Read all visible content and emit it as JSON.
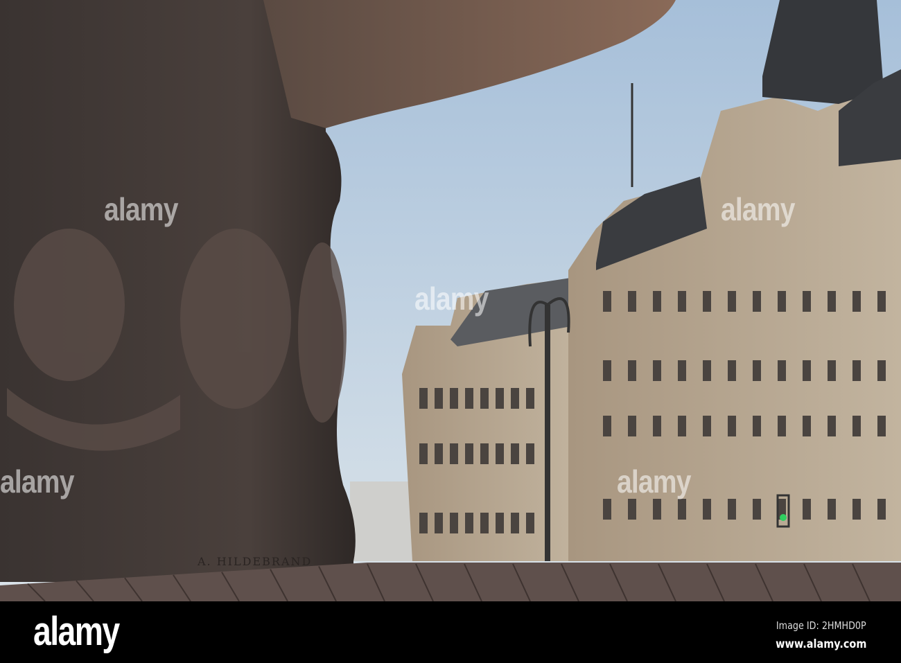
{
  "photo": {
    "subject": "Fountain base with carved faces in front of historic buildings",
    "inscription": "A. HILDEBRAND",
    "colors": {
      "sky_top": "#a9c2dc",
      "sky_bottom": "#d7e2ea",
      "stone": "#3e3634",
      "building": "#b7a68f",
      "roof": "#3a3c40",
      "wood": "#6b5650"
    }
  },
  "watermark": {
    "text": "alamy"
  },
  "footer": {
    "logo": "alamy",
    "image_id": "Image ID: 2HMHD0P",
    "url": "www.alamy.com"
  }
}
